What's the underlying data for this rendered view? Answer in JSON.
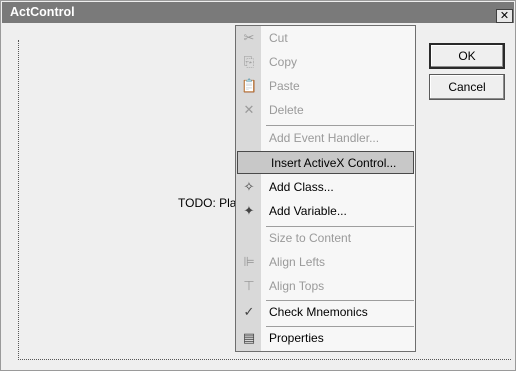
{
  "window": {
    "title": "ActControl",
    "close_glyph": "✕"
  },
  "dialog": {
    "todo_text": "TODO: Plac",
    "ok_label": "OK",
    "cancel_label": "Cancel"
  },
  "context_menu": {
    "items": [
      {
        "label": "Cut",
        "icon": "scissors-icon",
        "glyph": "✂",
        "enabled": false
      },
      {
        "label": "Copy",
        "icon": "copy-icon",
        "glyph": "⎘",
        "enabled": false
      },
      {
        "label": "Paste",
        "icon": "paste-icon",
        "glyph": "📋",
        "enabled": false
      },
      {
        "label": "Delete",
        "icon": "delete-icon",
        "glyph": "✕",
        "enabled": false
      },
      {
        "label": "Add Event Handler...",
        "icon": "",
        "glyph": "",
        "enabled": false
      },
      {
        "label": "Insert ActiveX Control...",
        "icon": "",
        "glyph": "",
        "enabled": true,
        "highlighted": true
      },
      {
        "label": "Add Class...",
        "icon": "add-class-icon",
        "glyph": "✧",
        "enabled": true
      },
      {
        "label": "Add Variable...",
        "icon": "add-variable-icon",
        "glyph": "✦",
        "enabled": true
      },
      {
        "label": "Size to Content",
        "icon": "",
        "glyph": "",
        "enabled": false
      },
      {
        "label": "Align Lefts",
        "icon": "align-lefts-icon",
        "glyph": "⊫",
        "enabled": false
      },
      {
        "label": "Align Tops",
        "icon": "align-tops-icon",
        "glyph": "⊤",
        "enabled": false
      },
      {
        "label": "Check Mnemonics",
        "icon": "check-mnemonics-icon",
        "glyph": "✓",
        "enabled": true
      },
      {
        "label": "Properties",
        "icon": "properties-icon",
        "glyph": "▤",
        "enabled": true
      }
    ]
  }
}
